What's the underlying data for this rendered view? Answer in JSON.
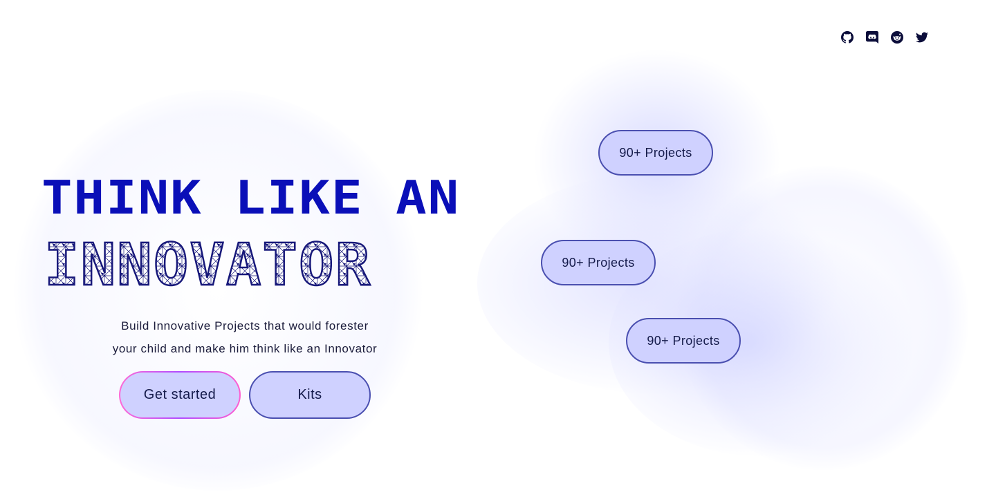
{
  "social": {
    "items": [
      {
        "name": "github-icon"
      },
      {
        "name": "discord-icon"
      },
      {
        "name": "reddit-icon"
      },
      {
        "name": "twitter-icon"
      }
    ],
    "icon_color": "#0b0d3a"
  },
  "hero": {
    "headline_line1": "THINK LIKE AN",
    "headline_line2": "INNOVATOR",
    "headline_color": "#0a0fb8",
    "headline_outline_color": "#17187a",
    "description_line1": "Build Innovative Projects that would forester",
    "description_line2": "your child and make him think like an Innovator",
    "primary_button": "Get started",
    "secondary_button": "Kits"
  },
  "projects": {
    "pills": [
      "90+ Projects",
      "90+ Projects",
      "90+ Projects"
    ],
    "pill_color": "#cfd1ff",
    "pill_border": "#4a4fb0"
  }
}
